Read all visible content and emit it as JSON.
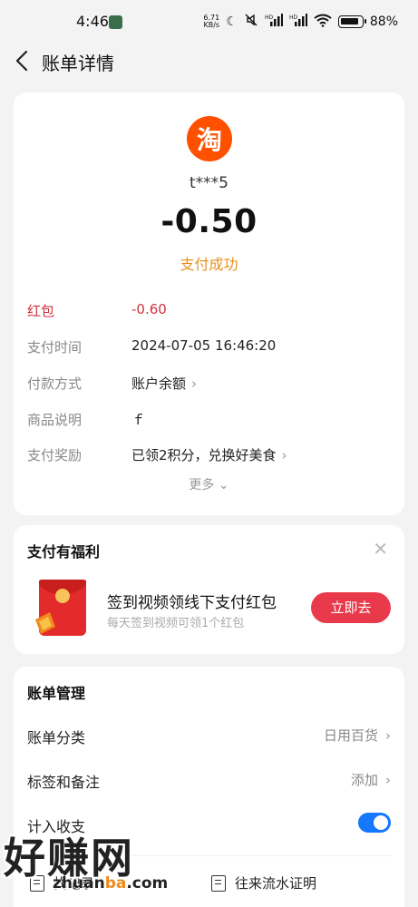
{
  "status_bar": {
    "time": "4:46",
    "net_speed_value": "6.71",
    "net_speed_unit": "KB/s",
    "battery": "88%",
    "icons": [
      "moon-icon",
      "mute-icon",
      "signal-hd-icon",
      "signal-hd-icon",
      "wifi-icon",
      "battery-icon"
    ]
  },
  "nav": {
    "title": "账单详情"
  },
  "bill": {
    "merchant_logo_char": "淘",
    "merchant_name": "t***5",
    "amount": "-0.50",
    "status": "支付成功",
    "rows": [
      {
        "label": "红包",
        "value": "-0.60"
      },
      {
        "label": "支付时间",
        "value": "2024-07-05 16:46:20"
      },
      {
        "label": "付款方式",
        "value": "账户余额"
      },
      {
        "label": "商品说明",
        "value": "ｆ"
      },
      {
        "label": "支付奖励",
        "value": "已领2积分，兑换好美食"
      }
    ],
    "more": "更多"
  },
  "benefit": {
    "title": "支付有福利",
    "main_text": "签到视频领线下支付红包",
    "sub_text": "每天签到视频可领1个红包",
    "button": "立即去"
  },
  "manage": {
    "title": "账单管理",
    "category_label": "账单分类",
    "category_value": "日用百货",
    "tags_label": "标签和备注",
    "tags_value": "添加",
    "income_label": "计入收支",
    "income_enabled": true,
    "link_left": "找记录",
    "link_right": "往来流水证明"
  },
  "watermark": {
    "text": "好赚网",
    "url_prefix": "zhuan",
    "url_mid": "ba",
    "url_suffix": ".com"
  },
  "colors": {
    "accent_red": "#e83a4a",
    "toggle_blue": "#1677ff",
    "status_orange": "#e8901e",
    "taobao_orange": "#ff5000"
  }
}
